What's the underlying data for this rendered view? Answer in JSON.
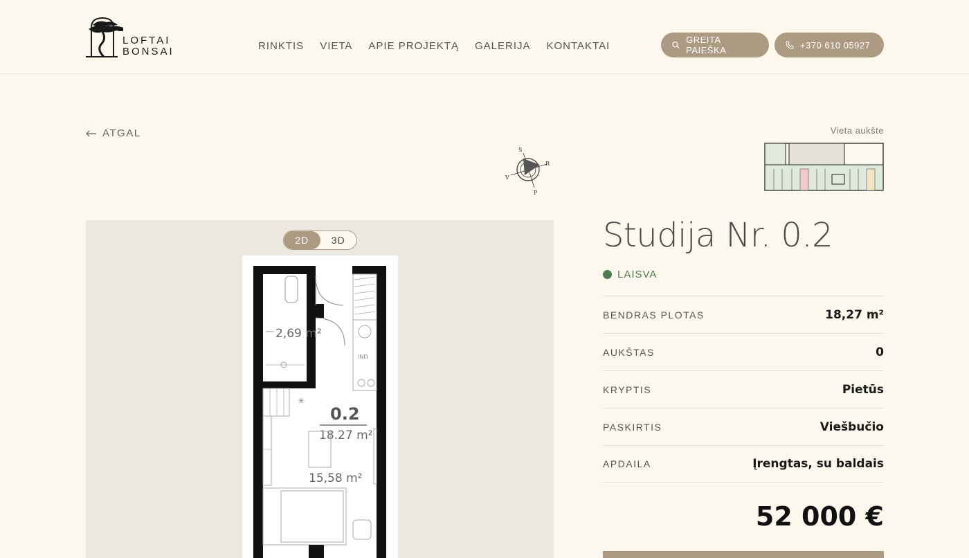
{
  "brand": {
    "line1": "LOFTAI",
    "line2": "BONSAI"
  },
  "nav": {
    "items": [
      "RINKTIS",
      "VIETA",
      "APIE PROJEKTĄ",
      "GALERIJA",
      "KONTAKTAI"
    ]
  },
  "header": {
    "search_label": "GREITA PAIEŠKA",
    "phone_label": "+370 610 05927"
  },
  "back_label": "ATGAL",
  "compass": {
    "n": "S",
    "e": "R",
    "s": "P",
    "w": "V"
  },
  "plan": {
    "view_options": [
      "2D",
      "3D"
    ],
    "active_view": "2D",
    "rooms": {
      "bath_area": "2,69 m²",
      "unit_number": "0.2",
      "unit_area": "18.27 m²",
      "main_area": "15,58 m²",
      "induction": "IND"
    }
  },
  "floor": {
    "label": "Vieta aukšte"
  },
  "unit": {
    "title": "Studija Nr. 0.2",
    "status": "LAISVA",
    "status_color": "#4f7b52",
    "specs": [
      {
        "label": "BENDRAS PLOTAS",
        "value": "18,27 m²"
      },
      {
        "label": "AUKŠTAS",
        "value": "0"
      },
      {
        "label": "KRYPTIS",
        "value": "Pietūs"
      },
      {
        "label": "PASKIRTIS",
        "value": "Viešbučio"
      },
      {
        "label": "APDAILA",
        "value": "Įrengtas, su baldais"
      }
    ],
    "price": "52 000 €"
  },
  "colors": {
    "accent": "#ad9a83",
    "background": "#fcf8ed",
    "panel": "#ebe8e0"
  }
}
